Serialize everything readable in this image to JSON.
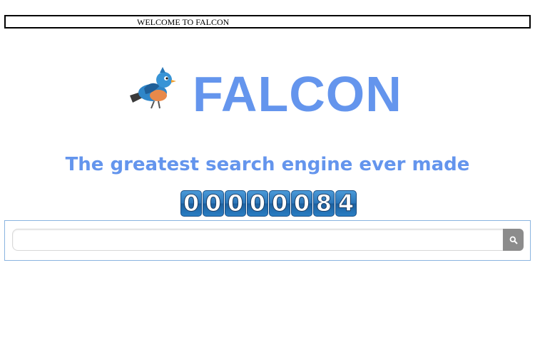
{
  "banner": {
    "text": "WELCOME TO FALCON"
  },
  "logo": {
    "brand_text": "FALCON",
    "icon": "bird-icon"
  },
  "tagline": {
    "text": "The greatest search engine ever made"
  },
  "hit_counter": {
    "value": "00000084",
    "digits": [
      "0",
      "0",
      "0",
      "0",
      "0",
      "0",
      "8",
      "4"
    ]
  },
  "search": {
    "value": "",
    "placeholder": "",
    "button_icon": "search-icon"
  },
  "colors": {
    "brand_blue": "#6495ed",
    "tagline_blue": "#6495ed",
    "counter_blue": "#2c76b9",
    "search_button": "#8c8c8c",
    "search_border": "#8ab4e0"
  }
}
